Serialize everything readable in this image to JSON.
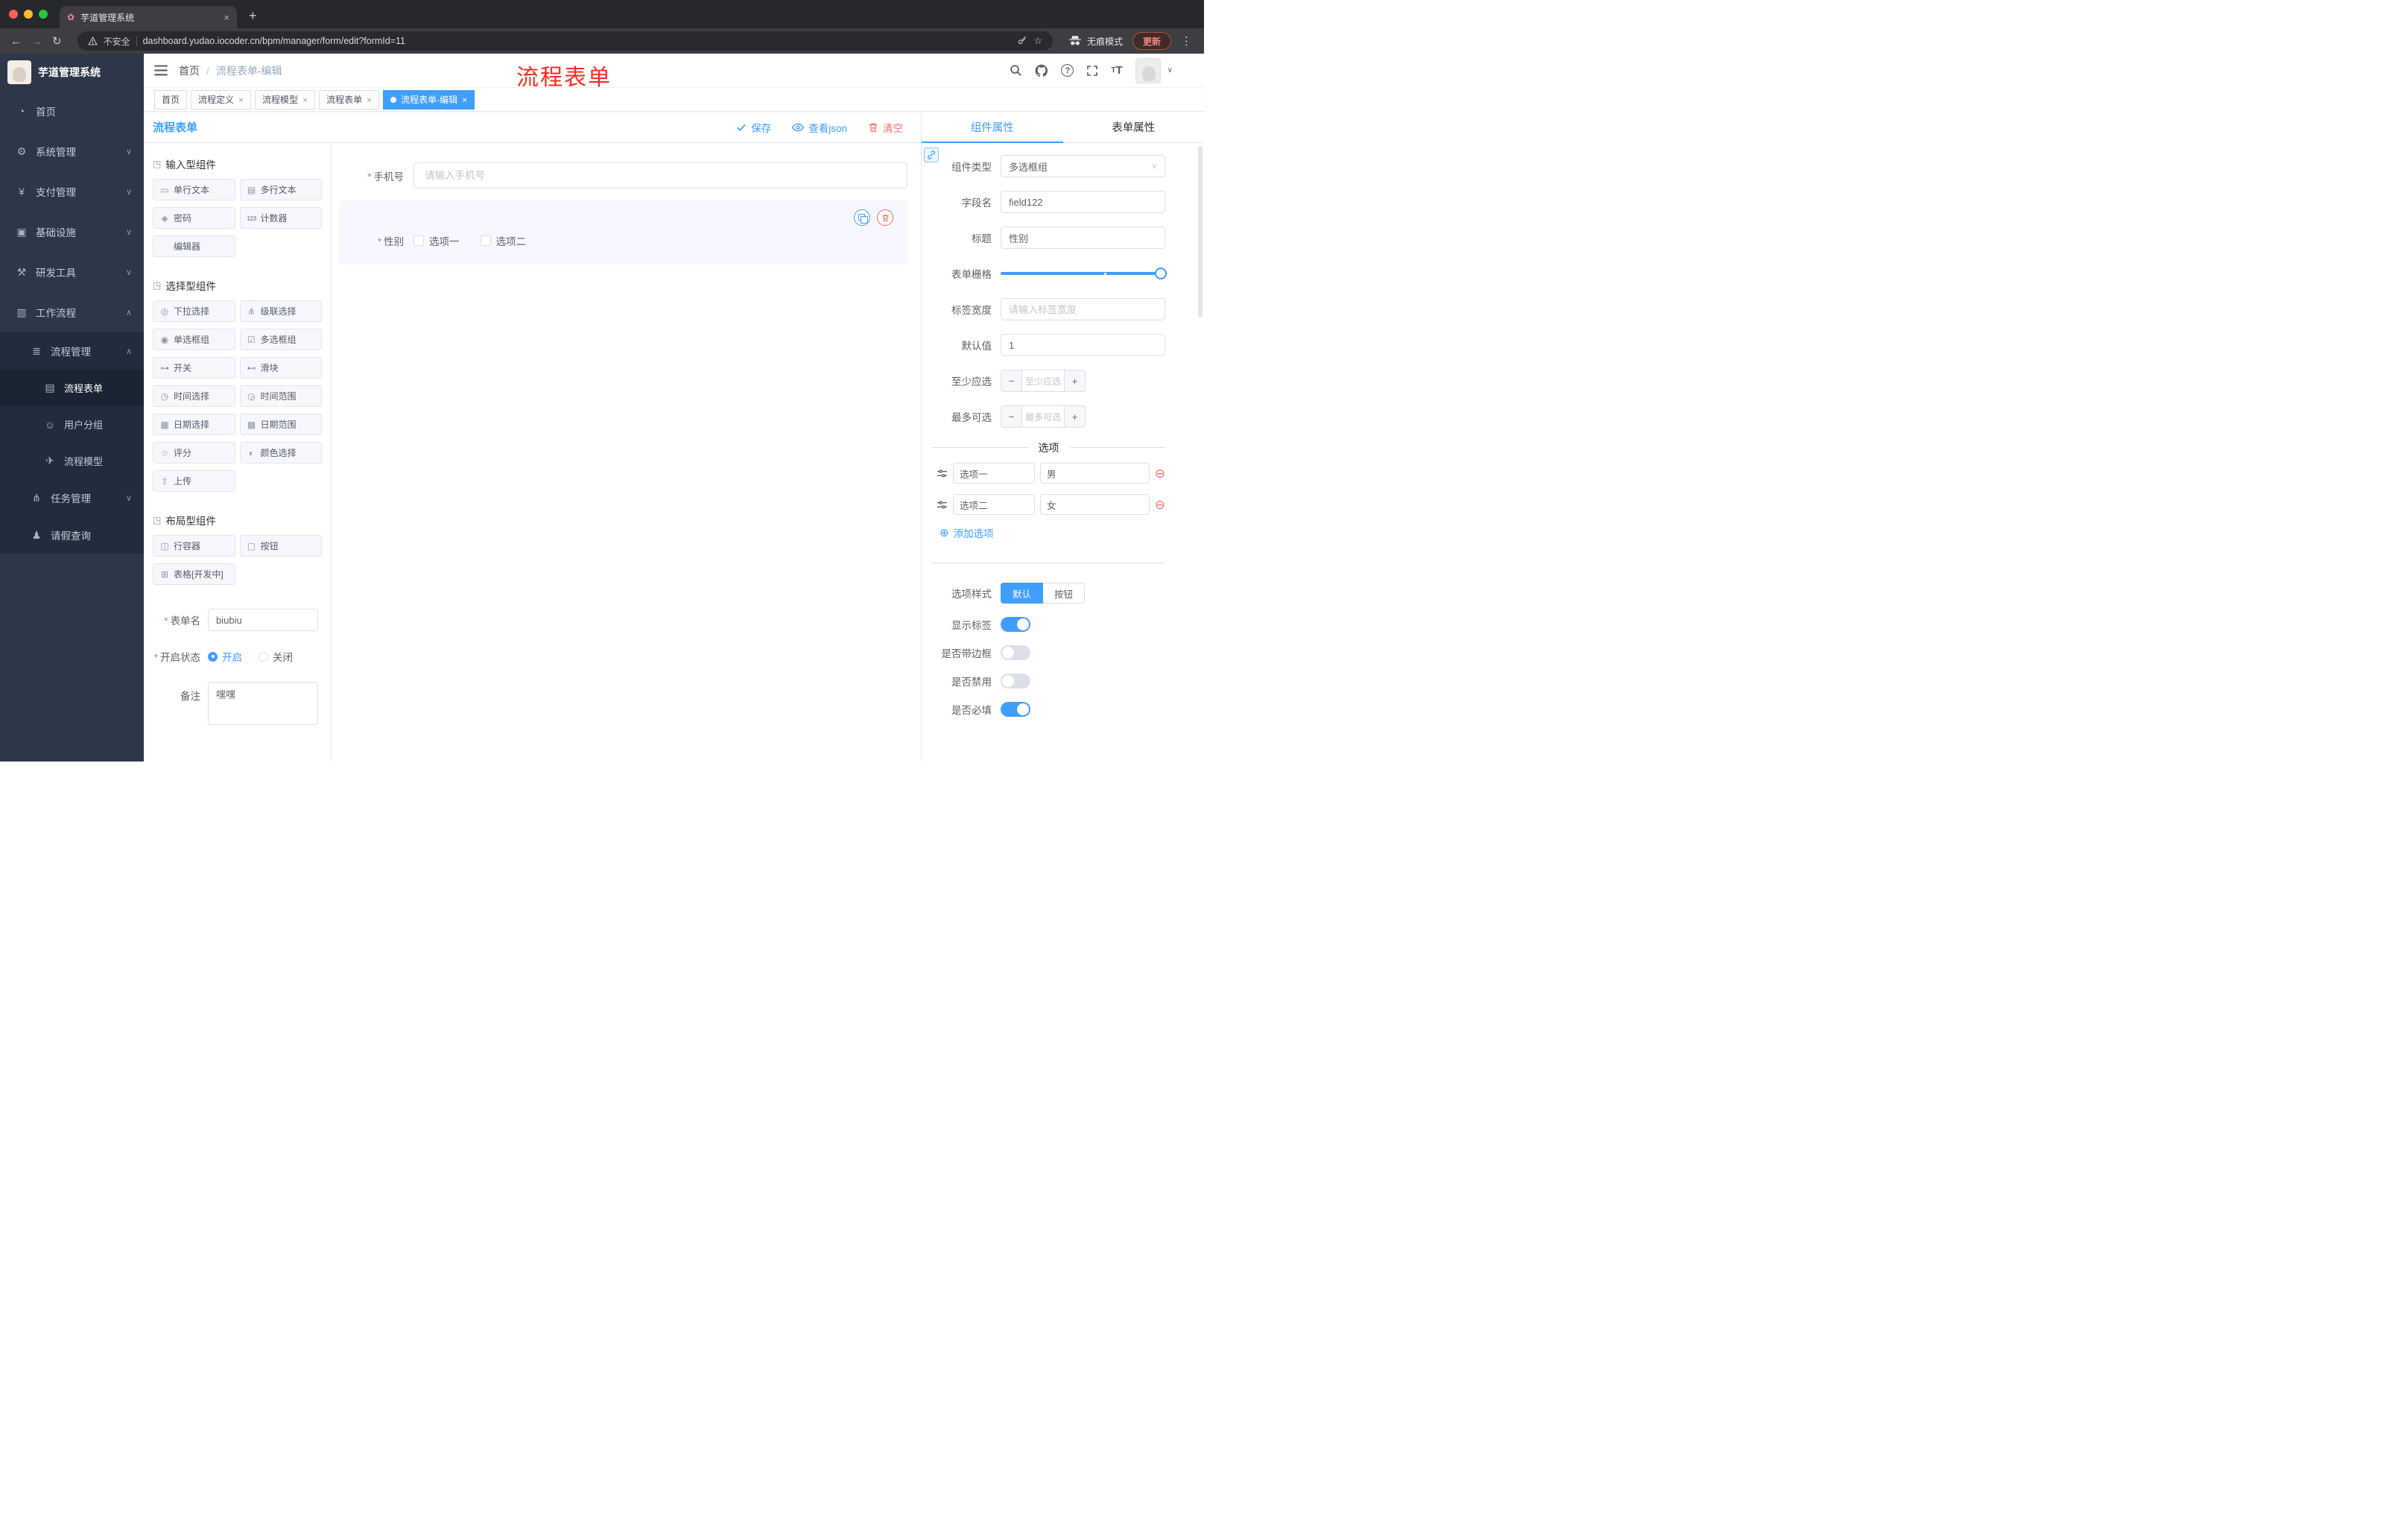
{
  "colors": {
    "accent": "#409eff",
    "danger": "#f56c6c",
    "annotation": "#fb2b20",
    "sidebar_bg": "#2c3848",
    "sidebar_sub_bg": "#212d3d"
  },
  "icons": {
    "caret_down": "∨",
    "caret_up": "∧",
    "close": "×",
    "plus": "+",
    "dot3": "⋮",
    "back": "←",
    "forward": "→",
    "reload": "↻",
    "star": "☆",
    "question": "?",
    "add": "⊕",
    "remove": "⊖",
    "slash": "/",
    "font_small": "T",
    "font_big": "T",
    "favicon": "✿"
  },
  "browser": {
    "tab_title": "芋道管理系统",
    "security": "不安全",
    "url": "dashboard.yudao.iocoder.cn/bpm/manager/form/edit?formId=11",
    "incognito": "无痕模式",
    "update": "更新"
  },
  "annotation": "流程表单",
  "sidebar": {
    "logo_title": "芋道管理系统",
    "items": [
      {
        "icon": "◔",
        "label": "首页"
      },
      {
        "icon": "⚙",
        "label": "系统管理",
        "chevron": "∨"
      },
      {
        "icon": "¥",
        "label": "支付管理",
        "chevron": "∨"
      },
      {
        "icon": "▣",
        "label": "基础设施",
        "chevron": "∨"
      },
      {
        "icon": "⚒",
        "label": "研发工具",
        "chevron": "∨"
      },
      {
        "icon": "▥",
        "label": "工作流程",
        "chevron": "∧"
      }
    ],
    "process_group": {
      "icon": "≣",
      "label": "流程管理",
      "chevron": "∧"
    },
    "process_items": [
      {
        "icon": "▤",
        "label": "流程表单"
      },
      {
        "icon": "☺",
        "label": "用户分组"
      },
      {
        "icon": "✈",
        "label": "流程模型"
      }
    ],
    "task_group": {
      "icon": "⋔",
      "label": "任务管理",
      "chevron": "∨"
    },
    "leave_item": {
      "icon": "♟",
      "label": "请假查询"
    }
  },
  "breadcrumb": {
    "home": "首页",
    "current": "流程表单-编辑"
  },
  "tags": [
    {
      "label": "首页"
    },
    {
      "label": "流程定义"
    },
    {
      "label": "流程模型"
    },
    {
      "label": "流程表单"
    },
    {
      "label": "流程表单-编辑"
    }
  ],
  "designer": {
    "panel_title": "流程表单",
    "actions": {
      "save": "保存",
      "view_json": "查看json",
      "clear": "清空"
    },
    "groups": [
      {
        "icon": "◳",
        "title": "输入型组件",
        "items": [
          {
            "icon": "▭",
            "label": "单行文本"
          },
          {
            "icon": "▤",
            "label": "多行文本"
          },
          {
            "icon": "◈",
            "label": "密码"
          },
          {
            "icon": "123",
            "label": "计数器"
          },
          {
            "icon": "",
            "label": "编辑器"
          }
        ]
      },
      {
        "icon": "◳",
        "title": "选择型组件",
        "items": [
          {
            "icon": "◎",
            "label": "下拉选择"
          },
          {
            "icon": "⋔",
            "label": "级联选择"
          },
          {
            "icon": "◉",
            "label": "单选框组"
          },
          {
            "icon": "☑",
            "label": "多选框组"
          },
          {
            "icon": "⊶",
            "label": "开关"
          },
          {
            "icon": "⊷",
            "label": "滑块"
          },
          {
            "icon": "◷",
            "label": "时间选择"
          },
          {
            "icon": "◶",
            "label": "时间范围"
          },
          {
            "icon": "▦",
            "label": "日期选择"
          },
          {
            "icon": "▩",
            "label": "日期范围"
          },
          {
            "icon": "☆",
            "label": "评分"
          },
          {
            "icon": "◐",
            "label": "颜色选择"
          },
          {
            "icon": "⇪",
            "label": "上传"
          }
        ]
      },
      {
        "icon": "◳",
        "title": "布局型组件",
        "items": [
          {
            "icon": "◫",
            "label": "行容器"
          },
          {
            "icon": "▢",
            "label": "按钮"
          },
          {
            "icon": "⊞",
            "label": "表格[开发中]"
          }
        ]
      }
    ],
    "meta": {
      "form_name_label": "表单名",
      "form_name_value": "biubiu",
      "status_label": "开启状态",
      "status_on": "开启",
      "status_off": "关闭",
      "remark_label": "备注",
      "remark_value": "嘿嘿"
    },
    "canvas": {
      "phone_label": "手机号",
      "phone_placeholder": "请输入手机号",
      "gender_label": "性别",
      "gender_options": [
        {
          "label": "选项一"
        },
        {
          "label": "选项二"
        }
      ]
    }
  },
  "props": {
    "tab_component": "组件属性",
    "tab_form": "表单属性",
    "component_type_label": "组件类型",
    "component_type_value": "多选框组",
    "field_name_label": "字段名",
    "field_name_value": "field122",
    "title_label": "标题",
    "title_value": "性别",
    "grid_label": "表单栅格",
    "label_width_label": "标签宽度",
    "label_width_placeholder": "请输入标签宽度",
    "default_label": "默认值",
    "default_value": "1",
    "min_label": "至少应选",
    "min_placeholder": "至少应选",
    "max_label": "最多可选",
    "max_placeholder": "最多可选",
    "options_title": "选项",
    "option_rows": [
      {
        "name": "选项一",
        "value": "男"
      },
      {
        "name": "选项二",
        "value": "女"
      }
    ],
    "add_option": "添加选项",
    "style_label": "选项样式",
    "style_default": "默认",
    "style_button": "按钮",
    "switch_rows": [
      {
        "label": "显示标签",
        "on": true
      },
      {
        "label": "是否带边框",
        "on": false
      },
      {
        "label": "是否禁用",
        "on": false
      },
      {
        "label": "是否必填",
        "on": true
      }
    ]
  }
}
